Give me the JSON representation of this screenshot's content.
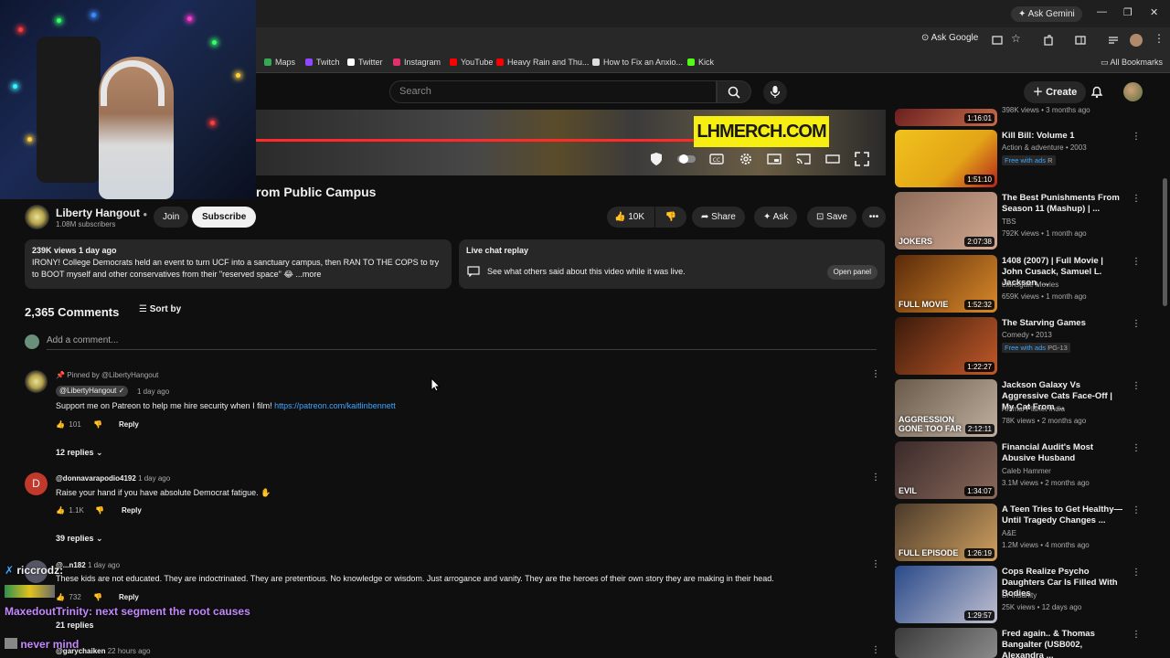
{
  "browser": {
    "gemini_label": "Ask Gemini",
    "ask_google_label": "Ask Google",
    "bookmarks": [
      {
        "label": "Maps",
        "color": "#34a853"
      },
      {
        "label": "Twitch",
        "color": "#9146ff"
      },
      {
        "label": "Twitter",
        "color": "#ffffff"
      },
      {
        "label": "Instagram",
        "color": "#e1306c"
      },
      {
        "label": "YouTube",
        "color": "#ff0000"
      },
      {
        "label": "Heavy Rain and Thu...",
        "color": "#ff0000"
      },
      {
        "label": "How to Fix an Anxio...",
        "color": "#dddddd"
      },
      {
        "label": "Kick",
        "color": "#53fc18"
      }
    ],
    "all_bookmarks_label": "All Bookmarks"
  },
  "header": {
    "search_placeholder": "Search",
    "create_label": "Create"
  },
  "video": {
    "banner_text": "LHMERCH.COM",
    "title_visible": "rom Public Campus",
    "channel_name": "Liberty Hangout",
    "subscribers": "1.08M subscribers",
    "join_label": "Join",
    "subscribe_label": "Subscribe",
    "likes": "10K",
    "share_label": "Share",
    "ask_label": "Ask",
    "save_label": "Save"
  },
  "description": {
    "stats": "239K views  1 day ago",
    "text": "IRONY! College Democrats held an event to turn UCF into a sanctuary campus, then RAN TO THE COPS to try to BOOT myself and other conservatives from their \"reserved space\" 😂 ...more"
  },
  "live_chat": {
    "heading": "Live chat replay",
    "text": "See what others said about this video while it was live.",
    "open_panel_label": "Open panel"
  },
  "comments": {
    "count": "2,365 Comments",
    "sort_label": "Sort by",
    "add_placeholder": "Add a comment...",
    "items": [
      {
        "pinned_label": "Pinned by @LibertyHangout",
        "author": "@LibertyHangout",
        "time": "1 day ago",
        "text": "Support me on Patreon to help me hire security when I film!",
        "link": "https://patreon.com/kaitlinbennett",
        "likes": "101",
        "reply_label": "Reply",
        "replies_label": "12 replies"
      },
      {
        "author": "@donnavarapodio4192",
        "time": "1 day ago",
        "text": "Raise your hand if you have absolute Democrat fatigue. ✋",
        "likes": "1.1K",
        "reply_label": "Reply",
        "replies_label": "39 replies",
        "avatar_letter": "D"
      },
      {
        "author": "@...n182",
        "time": "1 day ago",
        "text": "These kids are not educated. They are indoctrinated. They are pretentious. No knowledge or wisdom. Just arrogance and vanity. They are the heroes of their own story they are making in their head.",
        "likes": "732",
        "reply_label": "Reply",
        "replies_label": "21 replies"
      },
      {
        "author": "@garychaiken",
        "time": "22 hours ago"
      }
    ]
  },
  "recommendations": [
    {
      "title": "",
      "line1": "398K views • 3 months ago",
      "duration": "1:16:01"
    },
    {
      "title": "Kill Bill: Volume 1",
      "line1": "Action & adventure • 2003",
      "badge": "Free with ads",
      "rating": "R",
      "duration": "1:51:10"
    },
    {
      "title": "The Best Punishments From Season 11 (Mashup) | ...",
      "line1": "TBS",
      "line2": "792K views • 1 month ago",
      "duration": "2:07:38",
      "thumb_text": "JOKERS"
    },
    {
      "title": "1408 (2007) | Full Movie | John Cusack, Samuel L. Jackson, ...",
      "line1": "Lionsgate Movies",
      "line2": "659K views • 1 month ago",
      "duration": "1:52:32",
      "thumb_text": "FULL MOVIE"
    },
    {
      "title": "The Starving Games",
      "line1": "Comedy • 2013",
      "badge": "Free with ads",
      "rating": "PG-13",
      "duration": "1:22:27"
    },
    {
      "title": "Jackson Galaxy Vs Aggressive Cats Face-Off | My Cat From ...",
      "line1": "Animal Planet India",
      "line2": "78K views • 2 months ago",
      "duration": "2:12:11",
      "thumb_text": "AGGRESSION GONE TOO FAR"
    },
    {
      "title": "Financial Audit's Most Abusive Husband",
      "line1": "Caleb Hammer",
      "line2": "3.1M views • 2 months ago",
      "duration": "1:34:07",
      "thumb_text": "EVIL"
    },
    {
      "title": "A Teen Tries to Get Healthy—Until Tragedy Changes ...",
      "line1": "A&E",
      "line2": "1.2M views • 4 months ago",
      "duration": "1:26:19",
      "thumb_text": "FULL EPISODE"
    },
    {
      "title": "Cops Realize Psycho Daughters Car Is Filled With Bodies",
      "line1": "Dr Insanity",
      "line2": "25K views • 12 days ago",
      "duration": "1:29:57"
    },
    {
      "title": "Fred again.. & Thomas Bangalter (USB002, Alexandra ...",
      "line1": "",
      "line2": "",
      "duration": ""
    }
  ],
  "stream_chat": [
    {
      "user": "riccrodz:",
      "message": "",
      "color": "#f1f1f1"
    },
    {
      "user": "MaxedoutTrinity:",
      "message": "next segment the root causes",
      "color": "#c488ff"
    },
    {
      "user": "",
      "message": "never mind",
      "color": "#c488ff"
    }
  ],
  "colors": {
    "background": "#0f0f0f",
    "surface": "#272727",
    "link": "#3ea6ff",
    "accent_red": "#ff0000",
    "free_with_ads": "#3ea6ff"
  }
}
